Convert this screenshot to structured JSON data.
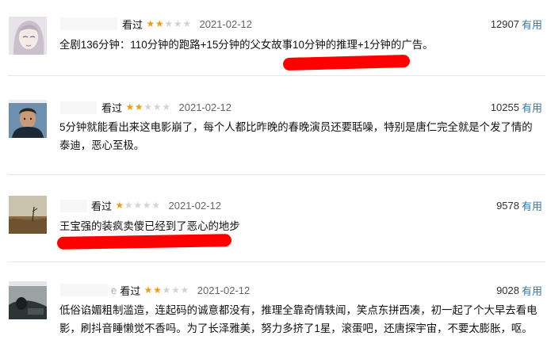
{
  "reviews": [
    {
      "user_status": "看过",
      "rating": 2,
      "date": "2021-02-12",
      "votes": "12907",
      "useful_label": "有用",
      "content": "全剧136分钟：110分钟的跑路+15分钟的父女故事10分钟的推理+1分钟的广告。",
      "avatar_icon": "anime-girl-avatar-icon"
    },
    {
      "user_status": "看过",
      "rating": 2,
      "date": "2021-02-12",
      "votes": "10255",
      "useful_label": "有用",
      "content": "5分钟就能看出来这电影崩了，每个人都比昨晚的春晚演员还要聒噪，特别是唐仁完全就是个发了情的泰迪，恶心至极。",
      "avatar_icon": "man-portrait-avatar-icon"
    },
    {
      "user_status": "看过",
      "rating": 1,
      "date": "2021-02-12",
      "votes": "9578",
      "useful_label": "有用",
      "content": "王宝强的装疯卖傻已经到了恶心的地步",
      "avatar_icon": "desert-landscape-avatar-icon"
    },
    {
      "user_prefix": "e",
      "user_status": "看过",
      "rating": 2,
      "date": "2021-02-12",
      "votes": "9028",
      "useful_label": "有用",
      "content": "低俗谄媚粗制滥造，连起码的诚意都没有，推理全靠奇情轶闻，笑点东拼西凑，初一起了个大早去看电影，刷抖音睡懒觉不香吗。为了长泽雅美，努力多挤了1星，滚蛋吧，还唐探宇宙，不要太膨胀，呕。",
      "avatar_icon": "dark-figure-avatar-icon"
    }
  ],
  "colors": {
    "star_on": "#e89d1d",
    "star_off": "#d3d3d3",
    "useful_link": "#3377aa",
    "highlight_mark": "#ff0000"
  }
}
